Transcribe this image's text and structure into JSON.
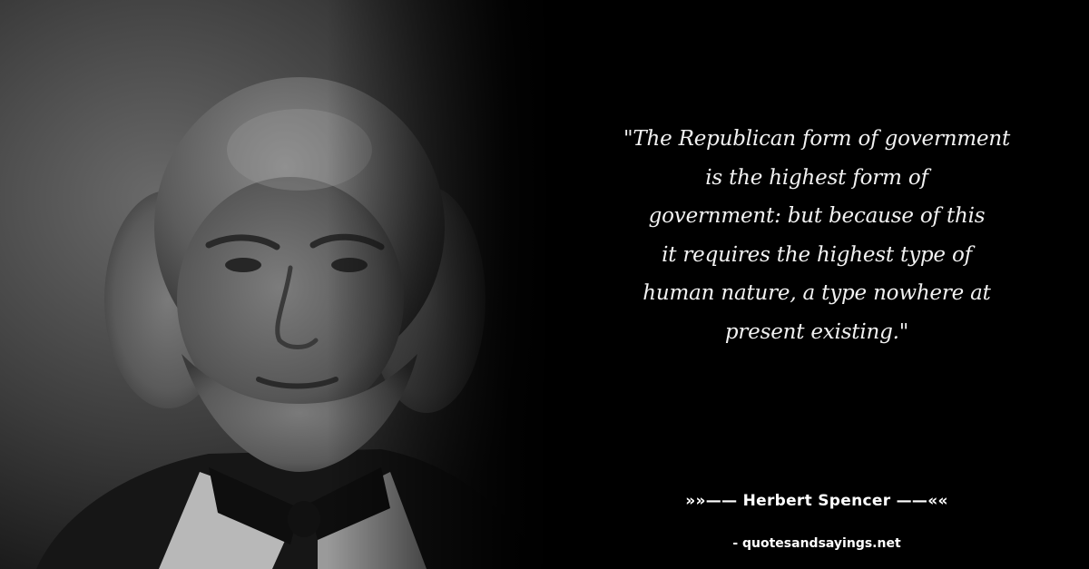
{
  "quote": {
    "lines": [
      "\"The Republican form of government",
      "is the highest form of",
      "government: but because of this",
      "it requires the highest type of",
      "human nature, a type nowhere at",
      "present existing.\""
    ]
  },
  "author": {
    "label": "»»—— Herbert Spencer ——««"
  },
  "footer": {
    "site": "- quotesandsayings.net"
  },
  "colors": {
    "background": "#000000",
    "text": "#f2f2f2"
  }
}
